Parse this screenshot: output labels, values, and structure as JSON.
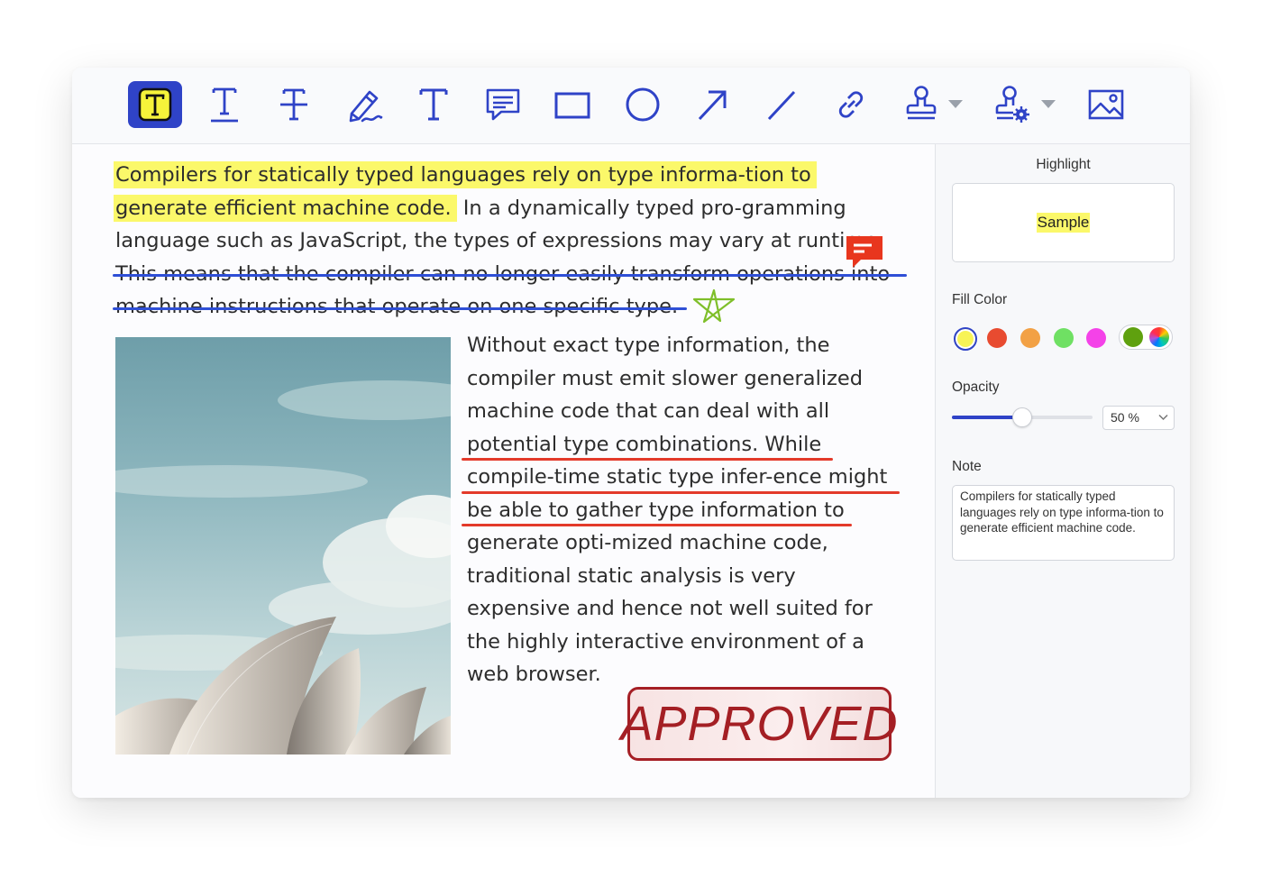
{
  "toolbar": {
    "tools": [
      {
        "id": "highlight-text",
        "active": true
      },
      {
        "id": "underline-text"
      },
      {
        "id": "strikethrough-text"
      },
      {
        "id": "pencil"
      },
      {
        "id": "text"
      },
      {
        "id": "comment"
      },
      {
        "id": "rectangle"
      },
      {
        "id": "circle"
      },
      {
        "id": "arrow"
      },
      {
        "id": "line"
      },
      {
        "id": "link"
      },
      {
        "id": "stamp",
        "has_dropdown": true
      },
      {
        "id": "custom-stamp",
        "has_dropdown": true
      },
      {
        "id": "image"
      }
    ],
    "accent_color": "#2f43c7",
    "active_fill": "#f6f33a"
  },
  "document": {
    "highlighted_line_1": "Compilers for statically typed languages rely on type informa-tion to",
    "highlighted_line_2": "generate efficient machine code.",
    "line_2_rest": " In a dynamically typed pro-gramming",
    "line_3": "language such as JavaScript, the types of expressions may vary at runtime.",
    "strike_line_1": "This means that the compiler can no longer easily transform operations into",
    "strike_line_2": "machine instructions that operate on one specific type.",
    "right_column": [
      "Without exact type information, the",
      "compiler must emit slower generalized",
      "machine code that can deal with all",
      "potential type combinations. While",
      "compile-time static type infer-ence might",
      "be able to gather type information to",
      "generate opti-mized machine code,",
      "traditional static analysis is very",
      "expensive and hence not well suited for",
      "the highly interactive environment of a",
      "web browser."
    ],
    "stamp_text": "APPROVED",
    "highlight_color": "#fbf86a",
    "strike_color": "#2f4fd6",
    "underline_color": "#e33a2a",
    "stamp_color": "#a41f24",
    "comment_color": "#e8361e",
    "star_color": "#7fbf2a"
  },
  "sidebar": {
    "title": "Highlight",
    "sample_text": "Sample",
    "fill_color_label": "Fill Color",
    "swatches": [
      "#f7f356",
      "#e84b30",
      "#f2a145",
      "#6fe063",
      "#f442e8",
      "#5fa10f"
    ],
    "selected_swatch": "#f7f356",
    "opacity_label": "Opacity",
    "opacity_value": "50 %",
    "opacity_fraction": 0.5,
    "note_label": "Note",
    "note_text": "Compilers for statically typed languages rely on type informa-tion to generate efficient machine code."
  }
}
